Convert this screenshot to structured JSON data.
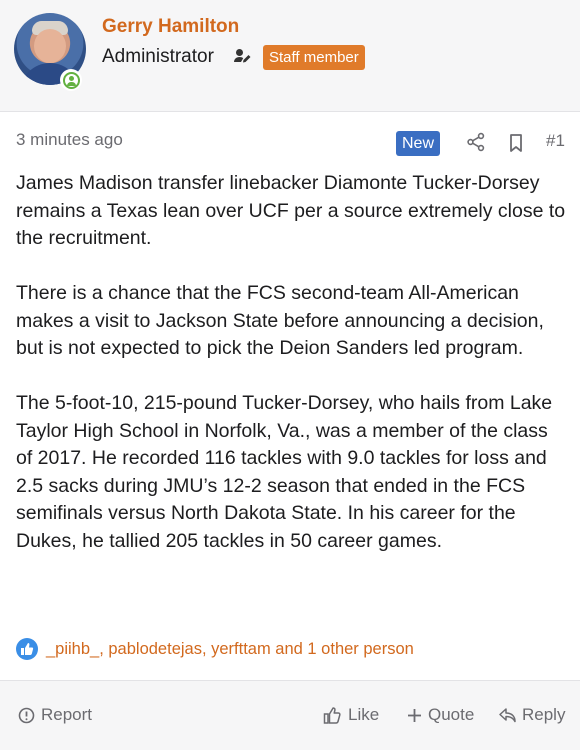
{
  "user": {
    "name": "Gerry Hamilton",
    "role": "Administrator",
    "staff_badge": "Staff member"
  },
  "post": {
    "time": "3 minutes ago",
    "new_badge": "New",
    "number": "#1",
    "paragraphs": [
      "James Madison transfer linebacker Diamonte Tucker-Dorsey remains a Texas lean over UCF per a source extremely close to the recruitment.",
      "There is a chance that the FCS second-team All-American makes a visit to Jackson State before announcing a decision, but is not expected to pick the Deion Sanders led program.",
      "The 5-foot-10, 215-pound Tucker-Dorsey, who hails from Lake Taylor High School in Norfolk, Va., was a member of the class of 2017. He recorded 116 tackles with 9.0 tackles for loss and 2.5 sacks during JMU’s 12-2 season that ended in the FCS semifinals versus North Dakota State. In his career for the Dukes, he tallied 205 tackles in 50 career games."
    ],
    "reactions": "_piihb_, pablodetejas, yerfttam and 1 other person"
  },
  "footer": {
    "report": "Report",
    "like": "Like",
    "quote": "Quote",
    "reply": "Reply"
  },
  "colors": {
    "accent": "#d2691e",
    "staff": "#e07b2a",
    "new": "#3a6ec2",
    "online": "#63b141"
  }
}
